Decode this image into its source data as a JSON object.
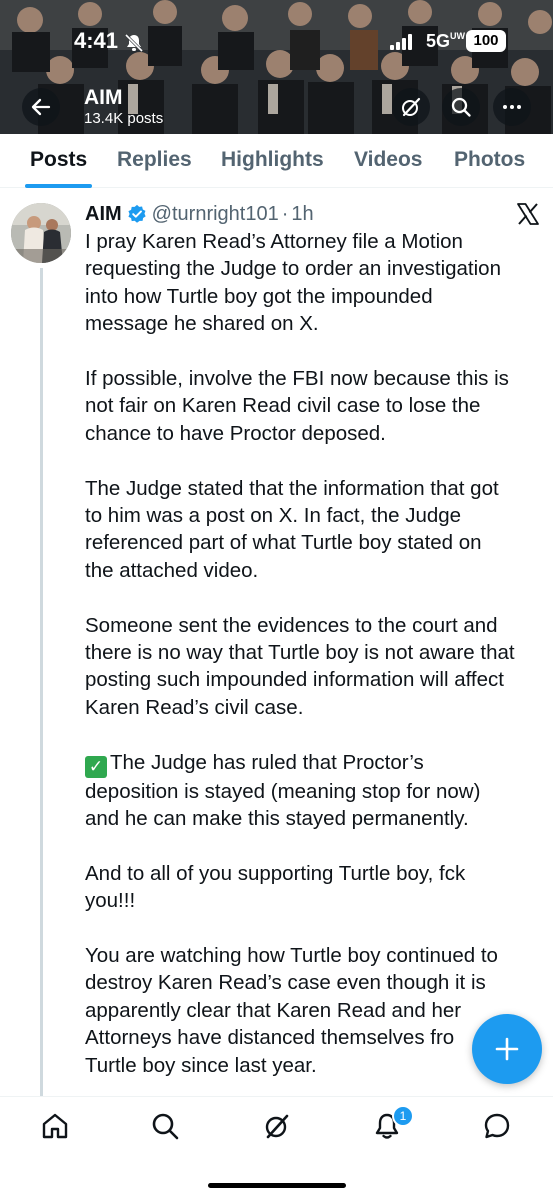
{
  "status_bar": {
    "time": "4:41",
    "network": "5G",
    "network_sub": "UW",
    "battery": "100"
  },
  "header": {
    "name": "AIM",
    "posts_count": "13.4K posts"
  },
  "tabs": [
    {
      "label": "Posts",
      "active": true
    },
    {
      "label": "Replies",
      "active": false
    },
    {
      "label": "Highlights",
      "active": false
    },
    {
      "label": "Videos",
      "active": false
    },
    {
      "label": "Photos",
      "active": false
    }
  ],
  "tweet": {
    "author": "AIM",
    "handle": "@turnright101",
    "separator": "·",
    "time": "1h",
    "paragraphs": [
      "I pray Karen Read’s Attorney file a Motion\nrequesting the Judge to order an investigation\ninto how Turtle boy got the impounded\nmessage he shared on X.",
      "If possible, involve the FBI now because this is\nnot fair on Karen Read civil case to lose the\nchance to have Proctor deposed.",
      "The Judge stated that the information that got\nto him was a post on X. In fact, the Judge\nreferenced part of what Turtle boy stated on\nthe attached video.",
      "Someone sent the evidences to the court and\nthere is no way that Turtle boy is not aware that\nposting such impounded information will affect\nKaren Read’s civil case.",
      "The Judge has ruled that Proctor’s\ndeposition is stayed (meaning stop for now)\nand he can make this stayed permanently.",
      "And to all of you supporting Turtle boy, fck\nyou!!!",
      "You are watching how Turtle boy continued to\ndestroy Karen Read’s case even though it is\napparently clear that Karen Read and her\nAttorneys have distanced themselves fro\nTurtle boy since last year."
    ],
    "check_emoji": "✓"
  },
  "bottom_nav": {
    "notification_count": "1"
  },
  "colors": {
    "accent": "#1d9bf0",
    "text": "#0f1419",
    "muted": "#536471",
    "check_green": "#2fa84f"
  },
  "icons": [
    "back-arrow-icon",
    "grok-icon",
    "search-icon",
    "more-icon",
    "verified-badge-icon",
    "x-logo-icon",
    "compose-plus-icon",
    "home-icon",
    "explore-search-icon",
    "grok-nav-icon",
    "notifications-bell-icon",
    "messages-icon",
    "bell-off-icon",
    "signal-icon"
  ]
}
